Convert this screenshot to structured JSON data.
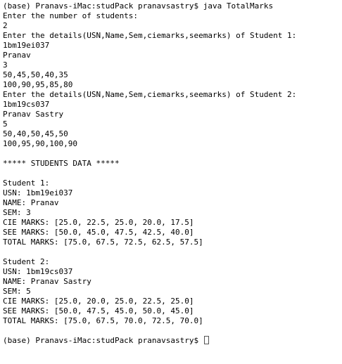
{
  "terminal": {
    "lines": [
      "(base) Pranavs-iMac:studPack pranavsastry$ java TotalMarks",
      "Enter the number of students:",
      "2",
      "Enter the details(USN,Name,Sem,ciemarks,seemarks) of Student 1:",
      "1bm19ei037",
      "Pranav",
      "3",
      "50,45,50,40,35",
      "100,90,95,85,80",
      "Enter the details(USN,Name,Sem,ciemarks,seemarks) of Student 2:",
      "1bm19cs037",
      "Pranav Sastry",
      "5",
      "50,40,50,45,50",
      "100,95,90,100,90",
      "",
      "***** STUDENTS DATA *****",
      "",
      "Student 1:",
      "USN: 1bm19ei037",
      "NAME: Pranav",
      "SEM: 3",
      "CIE MARKS: [25.0, 22.5, 25.0, 20.0, 17.5]",
      "SEE MARKS: [50.0, 45.0, 47.5, 42.5, 40.0]",
      "TOTAL MARKS: [75.0, 67.5, 72.5, 62.5, 57.5]",
      "",
      "Student 2:",
      "USN: 1bm19cs037",
      "NAME: Pranav Sastry",
      "SEM: 5",
      "CIE MARKS: [25.0, 20.0, 25.0, 22.5, 25.0]",
      "SEE MARKS: [50.0, 47.5, 45.0, 50.0, 45.0]",
      "TOTAL MARKS: [75.0, 67.5, 70.0, 72.5, 70.0]",
      ""
    ],
    "prompt": "(base) Pranavs-iMac:studPack pranavsastry$ "
  }
}
